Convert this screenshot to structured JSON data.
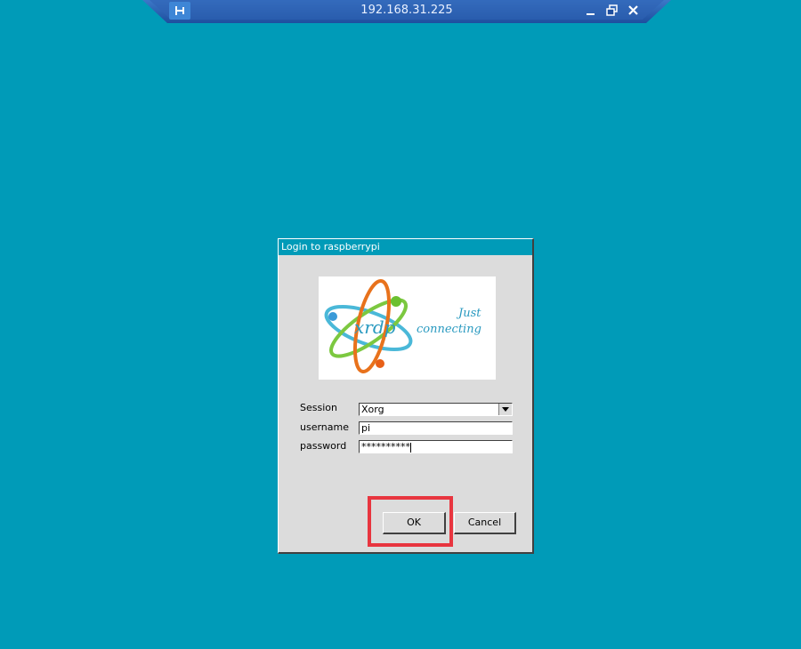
{
  "connection_bar": {
    "title": "192.168.31.225",
    "pin_icon": "pin-icon",
    "minimize_icon": "minimize-icon",
    "restore_icon": "restore-icon",
    "close_icon": "close-icon"
  },
  "dialog": {
    "title": "Login to raspberrypi",
    "logo": {
      "brand": "xrdp",
      "tagline_1": "Just",
      "tagline_2": "connecting"
    },
    "session": {
      "label": "Session",
      "value": "Xorg"
    },
    "username": {
      "label": "username",
      "value": "pi"
    },
    "password": {
      "label": "password",
      "value": "**********"
    },
    "ok_label": "OK",
    "cancel_label": "Cancel"
  },
  "colors": {
    "desktop": "#009bb8",
    "dialog_bg": "#dcdcdc",
    "highlight": "#e8353f"
  }
}
